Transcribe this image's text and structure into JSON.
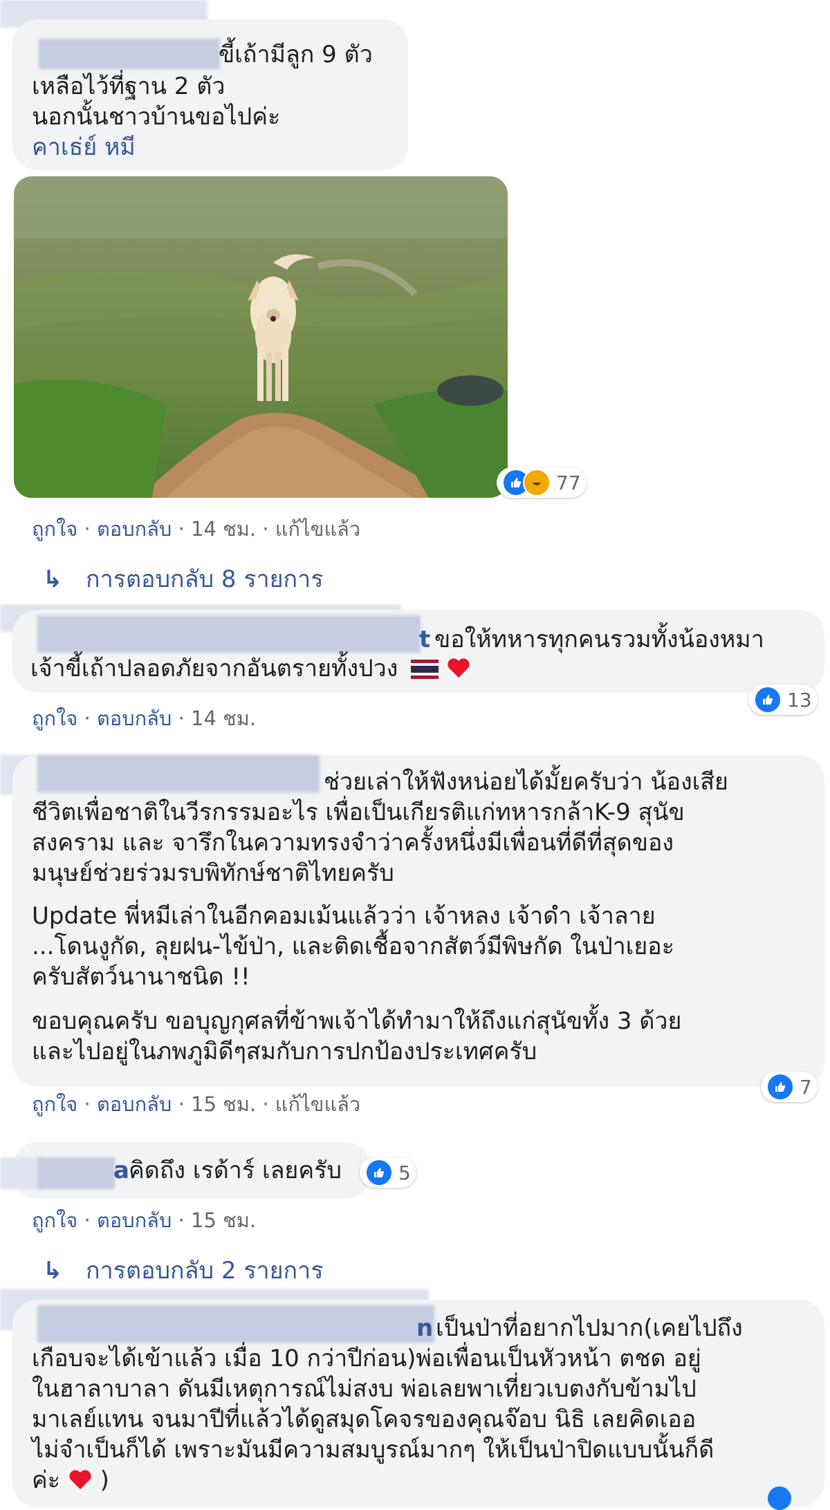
{
  "comments": [
    {
      "text_lines": [
        "ขี้เถ้ามีลูก 9 ตัว",
        "เหลือไว้ที่ฐาน 2 ตัว",
        "นอกนั้นชาวบ้านขอไปค่ะ"
      ],
      "tag": "คาเธ่ย์ หมี",
      "reaction_count": "77",
      "meta": {
        "like": "ถูกใจ",
        "reply": "ตอบกลับ",
        "time": "14 ชม.",
        "edited": "แก้ไขแล้ว"
      },
      "replies": "การตอบกลับ 8 รายการ"
    },
    {
      "name_tail": "t",
      "text_lines": [
        "ขอให้ทหารทุกคนรวมทั้งน้องหมา",
        "เจ้าขี้เถ้าปลอดภัยจากอันตรายทั้งปวง"
      ],
      "reaction_count": "13",
      "meta": {
        "like": "ถูกใจ",
        "reply": "ตอบกลับ",
        "time": "14 ชม."
      }
    },
    {
      "p1_lines": [
        "ช่วยเล่าให้ฟังหน่อยได้มั้ยครับว่า น้องเสีย",
        "ชีวิตเพื่อชาติในวีรกรรมอะไร เพื่อเป็นเกียรติแก่ทหารกล้าK-9 สุนัข",
        "สงคราม และ จารึกในความทรงจำว่าครั้งหนึ่งมีเพื่อนที่ดีที่สุดของ",
        "มนุษย์ช่วยร่วมรบพิทักษ์ชาติไทยครับ"
      ],
      "p2_lines": [
        "Update พี่หมีเล่าในอีกคอมเม้นแล้วว่า เจ้าหลง เจ้าดำ เจ้าลาย",
        "...โดนงูกัด, ลุยฝน-ไข้ป่า, และติดเชื้อจากสัตว์มีพิษกัด ในป่าเยอะ",
        "ครับสัตว์นานาชนิด !!"
      ],
      "p3_lines": [
        "ขอบคุณครับ ขอบุญกุศลที่ข้าพเจ้าได้ทำมาให้ถึงแก่สุนัขทั้ง 3 ด้วย",
        "และไปอยู่ในภพภูมิดีๆสมกับการปกป้องประเทศครับ"
      ],
      "reaction_count": "7",
      "meta": {
        "like": "ถูกใจ",
        "reply": "ตอบกลับ",
        "time": "15 ชม.",
        "edited": "แก้ไขแล้ว"
      }
    },
    {
      "name_tail": "a",
      "text": "คิดถึง เรด้าร์ เลยครับ",
      "reaction_count": "5",
      "meta": {
        "like": "ถูกใจ",
        "reply": "ตอบกลับ",
        "time": "15 ชม."
      },
      "replies": "การตอบกลับ 2 รายการ"
    },
    {
      "name_tail": "n",
      "text_lines": [
        "เป็นป่าที่อยากไปมาก(เคยไปถึง",
        "เกือบจะได้เข้าแล้ว เมื่อ 10 กว่าปีก่อน)พ่อเพื่อนเป็นหัวหน้า ตชด อยู่",
        "ในฮาลาบาลา ดันมีเหตุการณ์ไม่สงบ พ่อเลยพาเที่ยวเบตงกับข้ามไป",
        "มาเลย์แทน จนมาปีที่แล้วได้ดูสมุดโคจรของคุณจ๊อบ นิธิ เลยคิดเออ",
        "ไม่จำเป็นก็ได้ เพราะมันมีความสมบูรณ์มากๆ ให้เป็นป่าปิดแบบนั้นก็ดี",
        "ค่ะ"
      ],
      "tail": ")"
    }
  ],
  "colors": {
    "link": "#385898",
    "bubble": "#f2f3f5",
    "like": "#1877f2"
  },
  "icons": [
    "reply-arrow-icon",
    "like-icon",
    "haha-icon",
    "love-icon",
    "thai-flag-icon",
    "heart-icon"
  ]
}
